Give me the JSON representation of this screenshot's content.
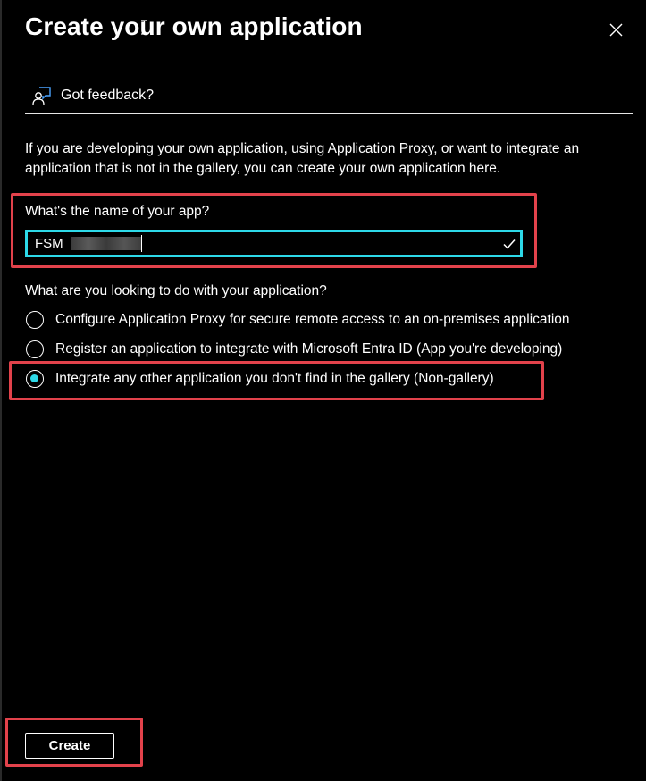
{
  "dialog": {
    "title": "Create your own application",
    "close_icon": "close-icon"
  },
  "feedback": {
    "icon": "feedback-person-icon",
    "label": "Got feedback?"
  },
  "description": "If you are developing your own application, using Application Proxy, or want to integrate an application that is not in the gallery, you can create your own application here.",
  "name_field": {
    "label": "What's the name of your app?",
    "value": "FSM",
    "value_redacted": true,
    "valid_icon": "checkmark-icon"
  },
  "purpose": {
    "question": "What are you looking to do with your application?",
    "options": [
      {
        "label": "Configure Application Proxy for secure remote access to an on-premises application",
        "selected": false
      },
      {
        "label": "Register an application to integrate with Microsoft Entra ID (App you're developing)",
        "selected": false
      },
      {
        "label": "Integrate any other application you don't find in the gallery (Non-gallery)",
        "selected": true
      }
    ]
  },
  "footer": {
    "create_label": "Create"
  },
  "colors": {
    "background": "#000000",
    "text": "#ffffff",
    "focus_accent": "#2dd9e8",
    "highlight_box": "#e2424b"
  }
}
